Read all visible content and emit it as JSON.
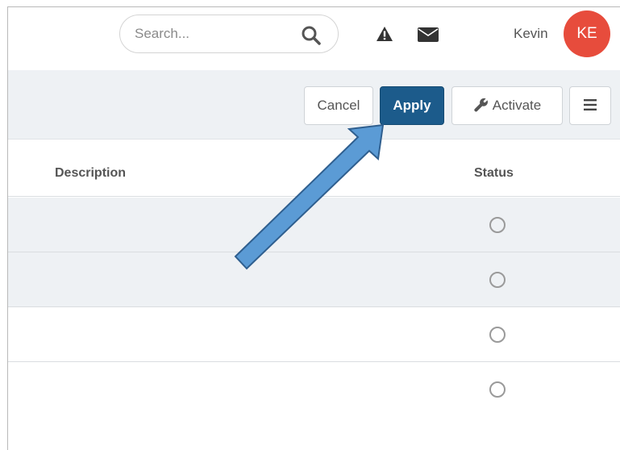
{
  "header": {
    "search": {
      "placeholder": "Search...",
      "value": ""
    },
    "icons": {
      "search": "search-icon",
      "alerts": "warning-icon",
      "messages": "mail-icon"
    },
    "user": {
      "name": "Kevin",
      "initials": "KE",
      "avatar_color": "#e74c3c"
    }
  },
  "toolbar": {
    "cancel_label": "Cancel",
    "apply_label": "Apply",
    "activate_label": "Activate",
    "activate_icon": "wrench-icon",
    "menu_icon": "hamburger-menu-icon",
    "apply_color": "#1c5b8b"
  },
  "table": {
    "columns": [
      "Description",
      "Status"
    ],
    "rows": [
      {
        "description": "",
        "status": "unchecked"
      },
      {
        "description": "",
        "status": "unchecked"
      },
      {
        "description": "",
        "status": "unchecked"
      },
      {
        "description": "",
        "status": "unchecked"
      }
    ]
  },
  "annotation": {
    "type": "arrow",
    "points_to": "apply-button",
    "color": "#5b9bd5"
  }
}
